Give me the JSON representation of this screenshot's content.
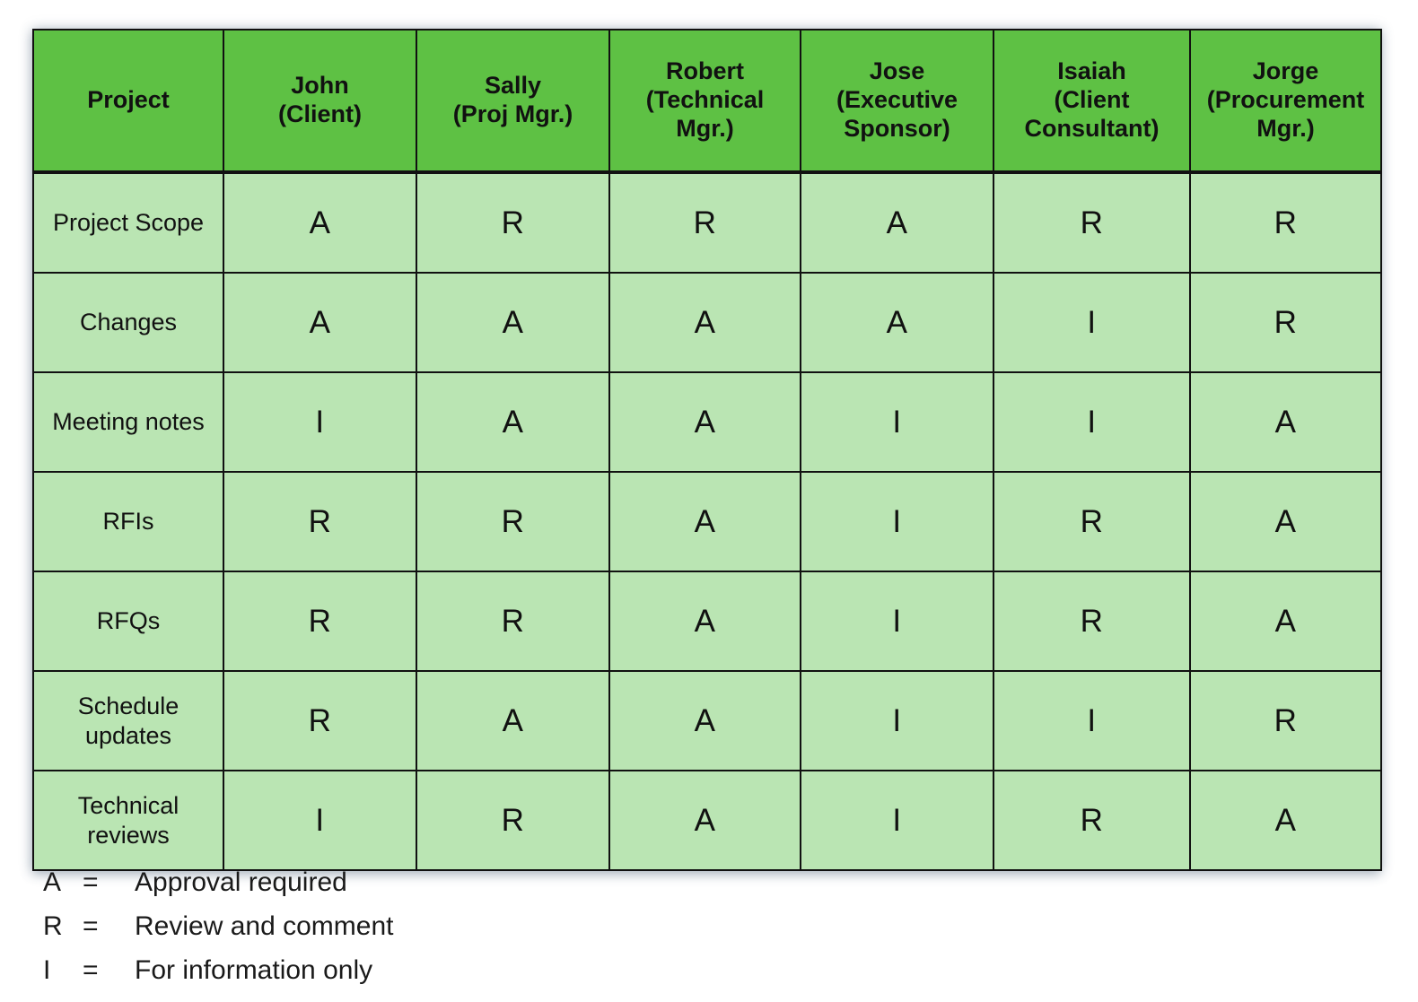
{
  "table": {
    "columns": [
      {
        "id": "project",
        "label": "Project"
      },
      {
        "id": "john",
        "label": "John\n(Client)"
      },
      {
        "id": "sally",
        "label": "Sally\n(Proj Mgr.)"
      },
      {
        "id": "robert",
        "label": "Robert\n(Technical Mgr.)"
      },
      {
        "id": "jose",
        "label": "Jose\n(Executive Sponsor)"
      },
      {
        "id": "isaiah",
        "label": "Isaiah\n(Client Consultant)"
      },
      {
        "id": "jorge",
        "label": "Jorge\n(Procurement Mgr.)"
      }
    ],
    "column_labels_flat": [
      "Project",
      "John (Client)",
      "Sally (Proj Mgr.)",
      "Robert (Technical Mgr.)",
      "Jose (Executive Sponsor)",
      "Isaiah (Client Consultant)",
      "Jorge (Procurement Mgr.)"
    ],
    "rows": [
      {
        "label": "Project Scope",
        "values": [
          "A",
          "R",
          "R",
          "A",
          "R",
          "R"
        ]
      },
      {
        "label": "Changes",
        "values": [
          "A",
          "A",
          "A",
          "A",
          "I",
          "R"
        ]
      },
      {
        "label": "Meeting notes",
        "values": [
          "I",
          "A",
          "A",
          "I",
          "I",
          "A"
        ]
      },
      {
        "label": "RFIs",
        "values": [
          "R",
          "R",
          "A",
          "I",
          "R",
          "A"
        ]
      },
      {
        "label": "RFQs",
        "values": [
          "R",
          "R",
          "A",
          "I",
          "R",
          "A"
        ]
      },
      {
        "label": "Schedule updates",
        "values": [
          "R",
          "A",
          "A",
          "I",
          "I",
          "R"
        ]
      },
      {
        "label": "Technical reviews",
        "values": [
          "I",
          "R",
          "A",
          "I",
          "R",
          "A"
        ]
      }
    ]
  },
  "legend": {
    "items": [
      {
        "symbol": "A",
        "equals": "=",
        "description": "Approval required"
      },
      {
        "symbol": "R",
        "equals": "=",
        "description": "Review and comment"
      },
      {
        "symbol": "I",
        "equals": "=",
        "description": "For information only"
      }
    ]
  },
  "colors": {
    "header_green": "#5ec144",
    "cell_green": "#bae5b3",
    "border": "#111111",
    "text": "#111111",
    "legend_text": "#1a1a1a",
    "page_background": "#ffffff"
  }
}
